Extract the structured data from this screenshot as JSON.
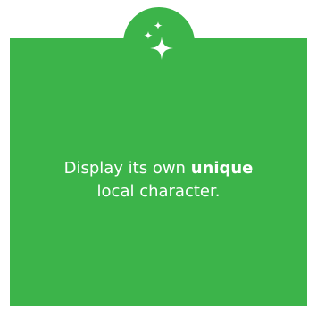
{
  "card": {
    "background_color": "#3cb44a",
    "icon": "sparkles-icon",
    "text_before": "Display its own ",
    "text_bold": "unique",
    "text_after": "local character."
  }
}
